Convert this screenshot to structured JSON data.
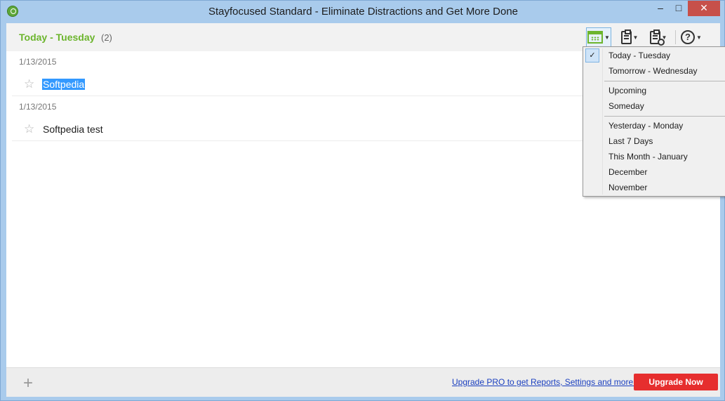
{
  "window": {
    "title": "Stayfocused Standard - Eliminate Distractions and Get More Done",
    "minimize": "–",
    "maximize": "□",
    "close": "✕"
  },
  "header": {
    "title": "Today - Tuesday",
    "count": "(2)"
  },
  "toolbar": {
    "calendar_icon": "calendar-icon",
    "tasklist_icon": "clipboard-list-icon",
    "history_icon": "clipboard-clock-icon",
    "help_icon": "help-icon",
    "help_glyph": "?",
    "caret": "▼"
  },
  "tasks": [
    {
      "date": "1/13/2015",
      "text": "Softpedia",
      "selected": true
    },
    {
      "date": "1/13/2015",
      "text": "Softpedia test",
      "selected": false
    }
  ],
  "footer": {
    "add_glyph": "+",
    "upgrade_link": "Upgrade PRO to get Reports, Settings and more.",
    "upgrade_button": "Upgrade Now"
  },
  "menu": {
    "check_glyph": "✓",
    "items": [
      {
        "label": "Today - Tuesday",
        "checked": true
      },
      {
        "label": "Tomorrow - Wednesday"
      },
      {
        "label": "Upcoming"
      },
      {
        "label": "Someday"
      },
      {
        "label": "Yesterday - Monday"
      },
      {
        "label": "Last 7 Days"
      },
      {
        "label": "This Month - January"
      },
      {
        "label": "December"
      },
      {
        "label": "November"
      }
    ]
  },
  "colors": {
    "accent_green": "#6cb52d",
    "upgrade_red": "#e62e2e",
    "selection_blue": "#3399ff",
    "link_blue": "#1a3fbf"
  }
}
